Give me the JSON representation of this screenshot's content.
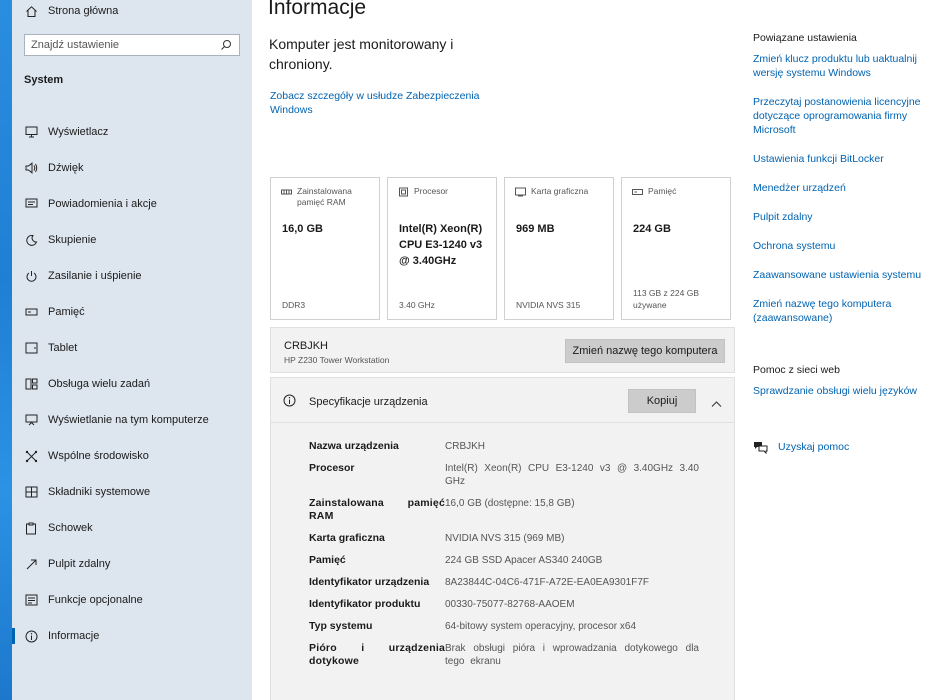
{
  "sidebar": {
    "home_label": "Strona główna",
    "search_placeholder": "Znajdź ustawienie",
    "section_title": "System",
    "items": [
      {
        "label": "Wyświetlacz",
        "icon": "monitor-icon"
      },
      {
        "label": "Dźwięk",
        "icon": "speaker-icon"
      },
      {
        "label": "Powiadomienia i akcje",
        "icon": "notification-icon"
      },
      {
        "label": "Skupienie",
        "icon": "moon-icon"
      },
      {
        "label": "Zasilanie i uśpienie",
        "icon": "power-icon"
      },
      {
        "label": "Pamięć",
        "icon": "storage-icon"
      },
      {
        "label": "Tablet",
        "icon": "tablet-icon"
      },
      {
        "label": "Obsługa wielu zadań",
        "icon": "multitasking-icon"
      },
      {
        "label": "Wyświetlanie na tym komputerze",
        "icon": "projecting-icon"
      },
      {
        "label": "Wspólne środowisko",
        "icon": "shared-experiences-icon"
      },
      {
        "label": "Składniki systemowe",
        "icon": "system-components-icon"
      },
      {
        "label": "Schowek",
        "icon": "clipboard-icon"
      },
      {
        "label": "Pulpit zdalny",
        "icon": "remote-desktop-icon"
      },
      {
        "label": "Funkcje opcjonalne",
        "icon": "optional-features-icon"
      },
      {
        "label": "Informacje",
        "icon": "info-icon",
        "active": true
      }
    ]
  },
  "main": {
    "title": "Informacje",
    "protection_text": "Komputer jest monitorowany i chroniony.",
    "protection_link": "Zobacz szczegóły w usłudze Zabezpieczenia Windows",
    "cards": [
      {
        "label": "Zainstalowana pamięć RAM",
        "value": "16,0 GB",
        "footer": "DDR3",
        "icon": "ram-icon"
      },
      {
        "label": "Procesor",
        "value": "Intel(R) Xeon(R) CPU E3-1240 v3 @ 3.40GHz",
        "footer": "3.40 GHz",
        "icon": "processor-icon"
      },
      {
        "label": "Karta graficzna",
        "value": "969 MB",
        "footer": "NVIDIA NVS 315",
        "icon": "graphics-card-icon"
      },
      {
        "label": "Pamięć",
        "value": "224 GB",
        "footer": "113 GB z 224 GB używane",
        "icon": "storage-icon"
      }
    ],
    "device_name": "CRBJKH",
    "device_model": "HP Z230 Tower Workstation",
    "rename_button": "Zmień nazwę tego komputera",
    "spec": {
      "title": "Specyfikacje urządzenia",
      "copy_button": "Kopiuj",
      "rows": [
        {
          "key": "Nazwa urządzenia",
          "value": "CRBJKH"
        },
        {
          "key": "Procesor",
          "value": "Intel(R) Xeon(R) CPU E3-1240 v3 @ 3.40GHz 3.40 GHz"
        },
        {
          "key": "Zainstalowana pamięć RAM",
          "value": "16,0 GB (dostępne: 15,8 GB)"
        },
        {
          "key": "Karta graficzna",
          "value": "NVIDIA NVS 315 (969 MB)"
        },
        {
          "key": "Pamięć",
          "value": "224 GB SSD Apacer AS340 240GB"
        },
        {
          "key": "Identyfikator urządzenia",
          "value": "8A23844C-04C6-471F-A72E-EA0EA9301F7F"
        },
        {
          "key": "Identyfikator produktu",
          "value": "00330-75077-82768-AAOEM"
        },
        {
          "key": "Typ systemu",
          "value": "64-bitowy system operacyjny, procesor x64"
        },
        {
          "key": "Pióro i urządzenia dotykowe",
          "value": "Brak obsługi pióra i wprowadzania dotykowego dla tego ekranu"
        }
      ]
    }
  },
  "related": {
    "title": "Powiązane ustawienia",
    "links": [
      "Zmień klucz produktu lub uaktualnij wersję systemu Windows",
      "Przeczytaj postanowienia licencyjne dotyczące oprogramowania firmy Microsoft",
      "Ustawienia funkcji BitLocker",
      "Menedżer urządzeń",
      "Pulpit zdalny",
      "Ochrona systemu",
      "Zaawansowane ustawienia systemu",
      "Zmień nazwę tego komputera (zaawansowane)"
    ]
  },
  "help": {
    "title": "Pomoc z sieci web",
    "link": "Sprawdzanie obsługi wielu języków",
    "get_help": "Uzyskaj pomoc"
  }
}
